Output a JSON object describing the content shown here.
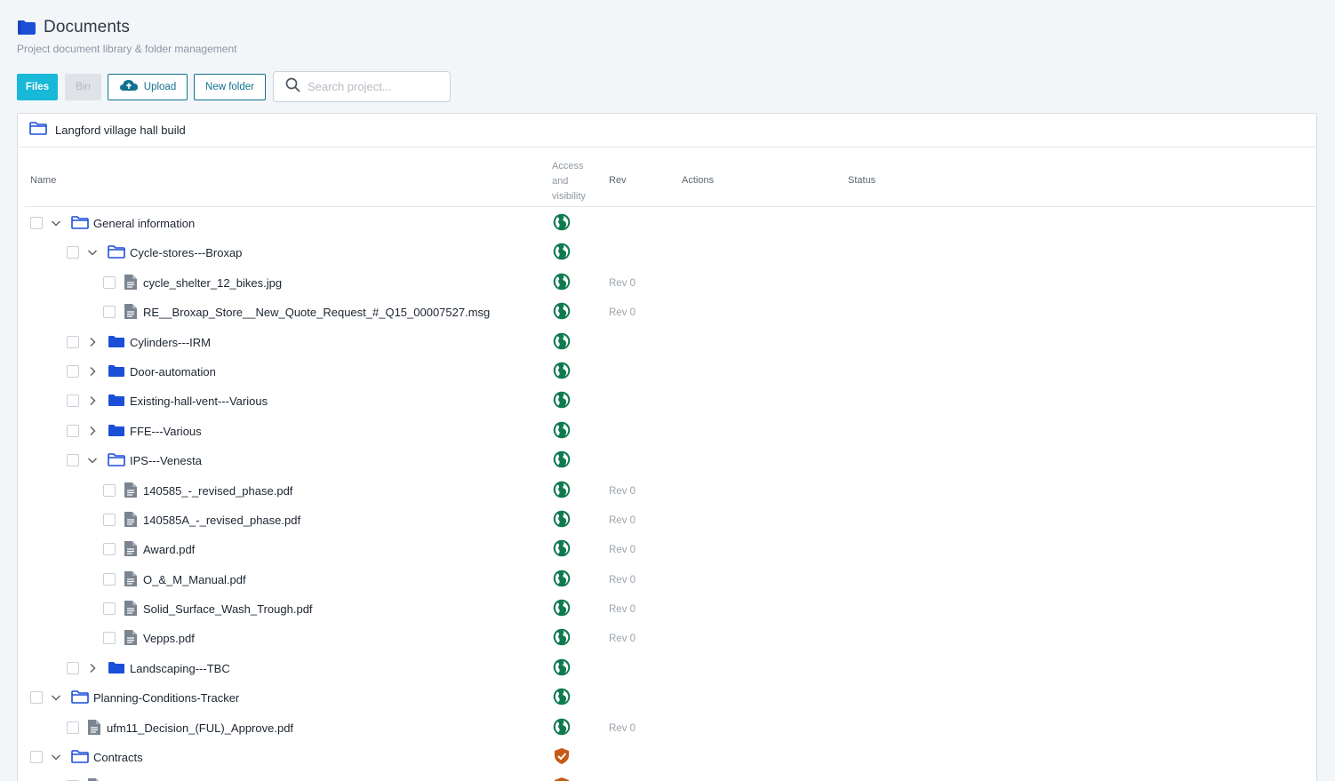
{
  "header": {
    "title": "Documents",
    "subtitle": "Project document library & folder management"
  },
  "toolbar": {
    "files_label": "Files",
    "bin_label": "Bin",
    "upload_label": "Upload",
    "new_folder_label": "New folder",
    "search_placeholder": "Search project..."
  },
  "project": {
    "name": "Langford village hall build"
  },
  "columns": {
    "name": "Name",
    "access": "Access and visibility",
    "rev": "Rev",
    "actions": "Actions",
    "status": "Status"
  },
  "colors": {
    "accent": "#17b8d8",
    "outline": "#10728f",
    "folder": "#1c4fd8",
    "public": "#0f7a4f",
    "restricted": "#c75a12"
  },
  "rows": [
    {
      "level": 0,
      "type": "folder",
      "expanded": true,
      "name": "General information",
      "access": "globe-icon",
      "rev": ""
    },
    {
      "level": 1,
      "type": "folder",
      "expanded": true,
      "name": "Cycle-stores---Broxap",
      "access": "globe-icon",
      "rev": ""
    },
    {
      "level": 2,
      "type": "file",
      "name": "cycle_shelter_12_bikes.jpg",
      "access": "globe-icon",
      "rev": "Rev 0"
    },
    {
      "level": 2,
      "type": "file",
      "name": "RE__Broxap_Store__New_Quote_Request_#_Q15_00007527.msg",
      "access": "globe-icon",
      "rev": "Rev 0"
    },
    {
      "level": 1,
      "type": "folder",
      "expanded": false,
      "name": "Cylinders---IRM",
      "access": "globe-icon",
      "rev": ""
    },
    {
      "level": 1,
      "type": "folder",
      "expanded": false,
      "name": "Door-automation",
      "access": "globe-icon",
      "rev": ""
    },
    {
      "level": 1,
      "type": "folder",
      "expanded": false,
      "name": "Existing-hall-vent---Various",
      "access": "globe-icon",
      "rev": ""
    },
    {
      "level": 1,
      "type": "folder",
      "expanded": false,
      "name": "FFE---Various",
      "access": "globe-icon",
      "rev": ""
    },
    {
      "level": 1,
      "type": "folder",
      "expanded": true,
      "name": "IPS---Venesta",
      "access": "globe-icon",
      "rev": ""
    },
    {
      "level": 2,
      "type": "file",
      "name": "140585_-_revised_phase.pdf",
      "access": "globe-icon",
      "rev": "Rev 0"
    },
    {
      "level": 2,
      "type": "file",
      "name": "140585A_-_revised_phase.pdf",
      "access": "globe-icon",
      "rev": "Rev 0"
    },
    {
      "level": 2,
      "type": "file",
      "name": "Award.pdf",
      "access": "globe-icon",
      "rev": "Rev 0"
    },
    {
      "level": 2,
      "type": "file",
      "name": "O_&_M_Manual.pdf",
      "access": "globe-icon",
      "rev": "Rev 0"
    },
    {
      "level": 2,
      "type": "file",
      "name": "Solid_Surface_Wash_Trough.pdf",
      "access": "globe-icon",
      "rev": "Rev 0"
    },
    {
      "level": 2,
      "type": "file",
      "name": "Vepps.pdf",
      "access": "globe-icon",
      "rev": "Rev 0"
    },
    {
      "level": 1,
      "type": "folder",
      "expanded": false,
      "name": "Landscaping---TBC",
      "access": "globe-icon",
      "rev": ""
    },
    {
      "level": 0,
      "type": "folder",
      "expanded": true,
      "name": "Planning-Conditions-Tracker",
      "access": "globe-icon",
      "rev": ""
    },
    {
      "level": 1,
      "type": "file",
      "name": "ufm11_Decision_(FUL)_Approve.pdf",
      "access": "globe-icon",
      "rev": "Rev 0"
    },
    {
      "level": 0,
      "type": "folder",
      "expanded": true,
      "name": "Contracts",
      "access": "shield-check-icon",
      "rev": ""
    },
    {
      "level": 1,
      "type": "file",
      "name": "",
      "access": "shield-check-icon",
      "rev": ""
    }
  ]
}
